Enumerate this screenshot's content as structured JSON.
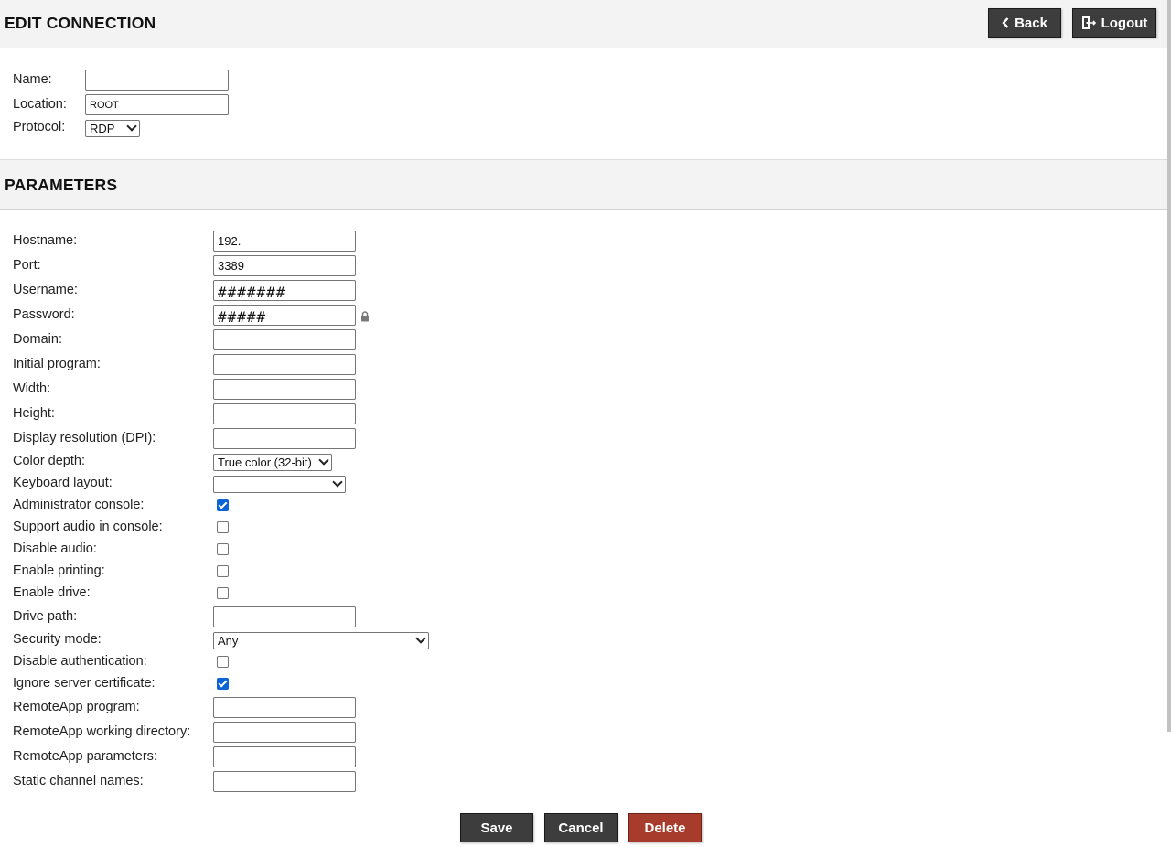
{
  "header": {
    "title": "EDIT CONNECTION",
    "back_label": "Back",
    "logout_label": "Logout"
  },
  "connection": {
    "name_label": "Name:",
    "name_value": "",
    "location_label": "Location:",
    "location_value": "ROOT",
    "protocol_label": "Protocol:",
    "protocol_value": "RDP"
  },
  "parameters": {
    "title": "PARAMETERS",
    "hostname": {
      "label": "Hostname:",
      "value": "192."
    },
    "port": {
      "label": "Port:",
      "value": "3389"
    },
    "username": {
      "label": "Username:",
      "value": "#######"
    },
    "password": {
      "label": "Password:",
      "value": "#####"
    },
    "domain": {
      "label": "Domain:",
      "value": ""
    },
    "initial_program": {
      "label": "Initial program:",
      "value": ""
    },
    "width": {
      "label": "Width:",
      "value": ""
    },
    "height": {
      "label": "Height:",
      "value": ""
    },
    "dpi": {
      "label": "Display resolution (DPI):",
      "value": ""
    },
    "color_depth": {
      "label": "Color depth:",
      "value": "True color (32-bit)"
    },
    "keyboard_layout": {
      "label": "Keyboard layout:",
      "value": ""
    },
    "admin_console": {
      "label": "Administrator console:",
      "checked": true
    },
    "console_audio": {
      "label": "Support audio in console:",
      "checked": false
    },
    "disable_audio": {
      "label": "Disable audio:",
      "checked": false
    },
    "enable_printing": {
      "label": "Enable printing:",
      "checked": false
    },
    "enable_drive": {
      "label": "Enable drive:",
      "checked": false
    },
    "drive_path": {
      "label": "Drive path:",
      "value": ""
    },
    "security_mode": {
      "label": "Security mode:",
      "value": "Any"
    },
    "disable_auth": {
      "label": "Disable authentication:",
      "checked": false
    },
    "ignore_cert": {
      "label": "Ignore server certificate:",
      "checked": true
    },
    "remoteapp_program": {
      "label": "RemoteApp program:",
      "value": ""
    },
    "remoteapp_dir": {
      "label": "RemoteApp working directory:",
      "value": ""
    },
    "remoteapp_params": {
      "label": "RemoteApp parameters:",
      "value": ""
    },
    "static_channels": {
      "label": "Static channel names:",
      "value": ""
    }
  },
  "actions": {
    "save_label": "Save",
    "cancel_label": "Cancel",
    "delete_label": "Delete"
  },
  "colors": {
    "header_bg": "#f3f3f3",
    "button_dark": "#3d3d3d",
    "button_danger": "#a83c2c",
    "checkbox_accent": "#0b63d6"
  },
  "icons": {
    "back": "chevron-left-icon",
    "logout": "logout-door-icon",
    "password_lock": "lock-icon"
  }
}
